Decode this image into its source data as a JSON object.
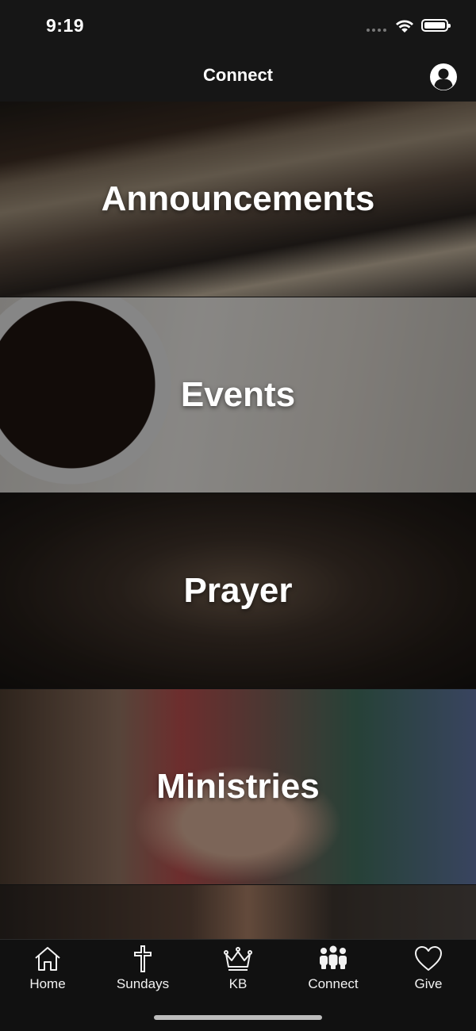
{
  "status_bar": {
    "time": "9:19"
  },
  "nav": {
    "title": "Connect",
    "profile_icon": "person-circle-icon"
  },
  "tiles": [
    {
      "label": "Announcements"
    },
    {
      "label": "Events"
    },
    {
      "label": "Prayer"
    },
    {
      "label": "Ministries"
    },
    {
      "label": ""
    }
  ],
  "tabbar": {
    "items": [
      {
        "label": "Home",
        "icon": "home-icon"
      },
      {
        "label": "Sundays",
        "icon": "cross-icon"
      },
      {
        "label": "KB",
        "icon": "crown-icon"
      },
      {
        "label": "Connect",
        "icon": "people-icon"
      },
      {
        "label": "Give",
        "icon": "heart-icon"
      }
    ],
    "active": "Connect"
  }
}
